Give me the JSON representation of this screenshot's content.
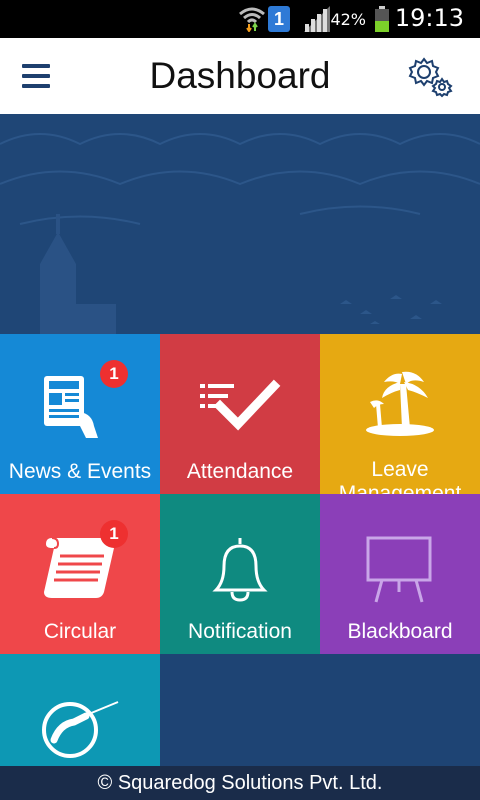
{
  "status_bar": {
    "sim_label": "1",
    "battery_percent": "42%",
    "time": "19:13",
    "icons": [
      "wifi-icon",
      "sim-icon",
      "signal-icon",
      "battery-icon"
    ]
  },
  "app_bar": {
    "title": "Dashboard",
    "icons": [
      "menu-icon",
      "settings-icon"
    ]
  },
  "tiles": [
    {
      "label": "News & Events",
      "badge": "1",
      "color": "#1589d6",
      "icon": "newspaper-icon"
    },
    {
      "label": "Attendance",
      "color": "#d13c44",
      "icon": "checklist-icon"
    },
    {
      "label": "Leave Management",
      "color": "#e6a912",
      "icon": "palm-tree-icon"
    },
    {
      "label": "Circular",
      "badge": "1",
      "color": "#ef474a",
      "icon": "scroll-icon"
    },
    {
      "label": "Notification",
      "color": "#0f8a80",
      "icon": "bell-icon"
    },
    {
      "label": "Blackboard",
      "color": "#8b3fb8",
      "icon": "blackboard-icon"
    },
    {
      "label": "",
      "color": "#0d98b4",
      "icon": "conductor-icon"
    }
  ],
  "footer": {
    "text": "© Squaredog Solutions Pvt. Ltd."
  }
}
